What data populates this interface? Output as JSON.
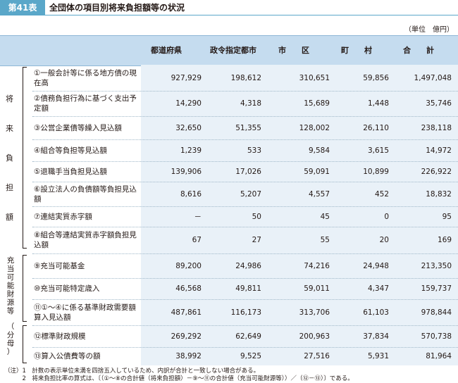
{
  "header": {
    "badge": "第41表",
    "title": "全団体の項目別将来負担額等の状況",
    "unit": "（単位　億円）"
  },
  "columns": [
    "都道府県",
    "政令指定都市",
    "市　　区",
    "町　　村",
    "合　　計"
  ],
  "groups": [
    {
      "label": "将来負担額",
      "rows": [
        1,
        2,
        3,
        4,
        5,
        6,
        7,
        8
      ]
    },
    {
      "label": "充当可能財源等",
      "rows": [
        9,
        10,
        11
      ]
    },
    {
      "label": "（分母）",
      "rows": [
        12,
        13
      ]
    }
  ],
  "rows": [
    {
      "label": "①一般会計等に係る地方債の現在高",
      "values": [
        "927,929",
        "198,612",
        "310,651",
        "59,856",
        "1,497,048"
      ]
    },
    {
      "label": "②債務負担行為に基づく支出予定額",
      "values": [
        "14,290",
        "4,318",
        "15,689",
        "1,448",
        "35,746"
      ]
    },
    {
      "label": "③公営企業債等繰入見込額",
      "values": [
        "32,650",
        "51,355",
        "128,002",
        "26,110",
        "238,118"
      ]
    },
    {
      "label": "④組合等負担等見込額",
      "values": [
        "1,239",
        "533",
        "9,584",
        "3,615",
        "14,972"
      ]
    },
    {
      "label": "⑤退職手当負担見込額",
      "values": [
        "139,906",
        "17,026",
        "59,091",
        "10,899",
        "226,922"
      ]
    },
    {
      "label": "⑥設立法人の負債額等負担見込額",
      "values": [
        "8,616",
        "5,207",
        "4,557",
        "452",
        "18,832"
      ]
    },
    {
      "label": "⑦連結実質赤字額",
      "values": [
        "－",
        "50",
        "45",
        "0",
        "95"
      ]
    },
    {
      "label": "⑧組合等連結実質赤字額負担見込額",
      "values": [
        "67",
        "27",
        "55",
        "20",
        "169"
      ]
    },
    {
      "label": "⑨充当可能基金",
      "values": [
        "89,200",
        "24,986",
        "74,216",
        "24,948",
        "213,350"
      ]
    },
    {
      "label": "⑩充当可能特定歳入",
      "values": [
        "46,568",
        "49,811",
        "59,011",
        "4,347",
        "159,737"
      ]
    },
    {
      "label": "⑪①～④に係る基準財政需要額算入見込額",
      "values": [
        "487,861",
        "116,173",
        "313,706",
        "61,103",
        "978,844"
      ]
    },
    {
      "label": "⑫標準財政規模",
      "values": [
        "269,292",
        "62,649",
        "200,963",
        "37,834",
        "570,738"
      ]
    },
    {
      "label": "⑬算入公債費等の額",
      "values": [
        "38,992",
        "9,525",
        "27,516",
        "5,931",
        "81,964"
      ]
    }
  ],
  "notes": [
    "（注）1　計数の表示単位未満を四捨五入しているため、内訳が合計と一致しない場合がある。",
    "　　　2　将来負担比率の算式は、〔（①～⑧の合計値（将来負担額）－⑨～⑪の合計値（充当可能財源等））／（⑫－⑬）〕である。"
  ]
}
